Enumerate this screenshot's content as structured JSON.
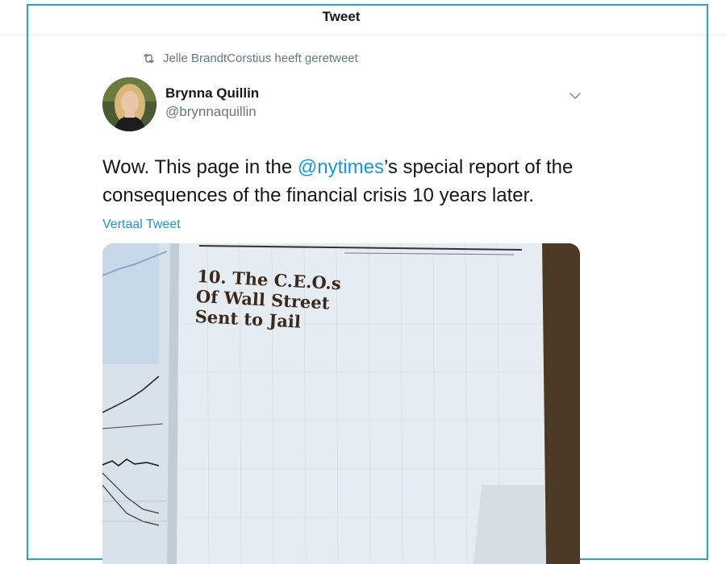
{
  "header": {
    "title": "Tweet"
  },
  "retweet": {
    "icon": "retweet-icon",
    "text": "Jelle BrandtCorstius heeft geretweet"
  },
  "author": {
    "name": "Brynna Quillin",
    "handle": "@brynnaquillin"
  },
  "tweet": {
    "text_before": "Wow. This page in the ",
    "mention": "@nytimes",
    "text_after": "’s special report of the consequences of the financial crisis 10 years later."
  },
  "translate_label": "Vertaal Tweet",
  "media": {
    "headline_lines": [
      "10. The C.E.O.s",
      "Of Wall Street",
      "Sent to Jail"
    ]
  },
  "colors": {
    "accent": "#1b95e0",
    "frame": "#2aa3c9"
  }
}
